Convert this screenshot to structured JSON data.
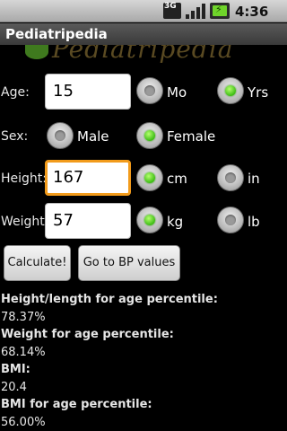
{
  "status_bar": {
    "network": "3G",
    "icons": [
      "3g-icon",
      "signal-icon",
      "battery-charging-icon"
    ],
    "time": "4:36 pm"
  },
  "app": {
    "title": "Pediatripedia",
    "logo_text": "Pediatripedia"
  },
  "form": {
    "age": {
      "label": "Age:",
      "value": "15",
      "unit_a": "Mo",
      "unit_b": "Yrs",
      "selected": "Yrs"
    },
    "sex": {
      "label": "Sex:",
      "opt_a": "Male",
      "opt_b": "Female",
      "selected": "Female"
    },
    "height": {
      "label": "Height:",
      "value": "167",
      "unit_a": "cm",
      "unit_b": "in",
      "selected": "cm"
    },
    "weight": {
      "label": "Weight:",
      "value": "57",
      "unit_a": "kg",
      "unit_b": "lb",
      "selected": "kg"
    }
  },
  "buttons": {
    "calculate": "Calculate!",
    "bp": "Go to BP values"
  },
  "results": [
    {
      "heading": "Height/length for age percentile:",
      "value": "78.37%"
    },
    {
      "heading": "Weight for age percentile:",
      "value": "68.14%"
    },
    {
      "heading": "BMI:",
      "value": "20.4"
    },
    {
      "heading": "BMI for age percentile:",
      "value": "56.00%"
    }
  ],
  "colors": {
    "accent_focus": "#f29b1b",
    "radio_selected": "#3dbd14",
    "background": "#000000"
  }
}
